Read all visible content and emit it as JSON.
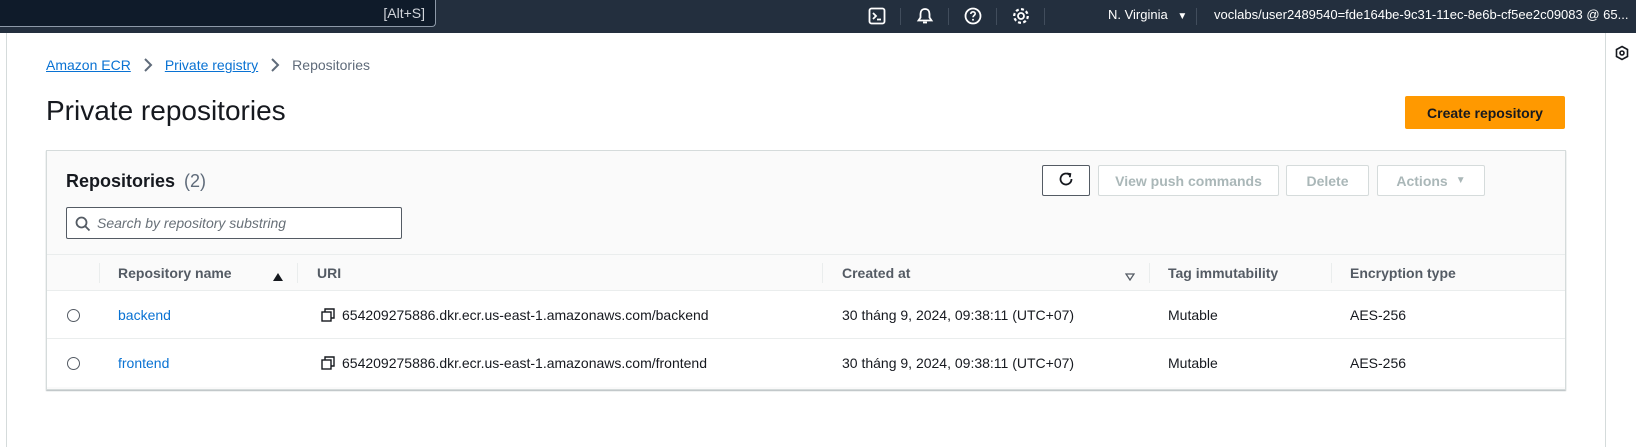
{
  "topbar": {
    "search_shortcut": "[Alt+S]",
    "region": "N. Virginia",
    "account": "voclabs/user2489540=fde164be-9c31-11ec-8e6b-cf5ee2c09083 @ 65...",
    "icons": [
      "cloudshell-icon",
      "notifications-icon",
      "help-icon",
      "settings-icon"
    ]
  },
  "breadcrumb": {
    "items": [
      "Amazon ECR",
      "Private registry"
    ],
    "current": "Repositories"
  },
  "page": {
    "title": "Private repositories",
    "create_button": "Create repository"
  },
  "repositories": {
    "title": "Repositories",
    "count": "(2)",
    "buttons": {
      "push": "View push commands",
      "delete": "Delete",
      "actions": "Actions"
    },
    "search_placeholder": "Search by repository substring",
    "columns": [
      "Repository name",
      "URI",
      "Created at",
      "Tag immutability",
      "Encryption type"
    ],
    "rows": [
      {
        "name": "backend",
        "uri": "654209275886.dkr.ecr.us-east-1.amazonaws.com/backend",
        "created_at": "30 tháng 9, 2024, 09:38:11 (UTC+07)",
        "tag_immutability": "Mutable",
        "encryption": "AES-256"
      },
      {
        "name": "frontend",
        "uri": "654209275886.dkr.ecr.us-east-1.amazonaws.com/frontend",
        "created_at": "30 tháng 9, 2024, 09:38:11 (UTC+07)",
        "tag_immutability": "Mutable",
        "encryption": "AES-256"
      }
    ]
  },
  "colors": {
    "nav_bg": "#232f3e",
    "primary": "#ff9900",
    "link": "#0972d3"
  }
}
